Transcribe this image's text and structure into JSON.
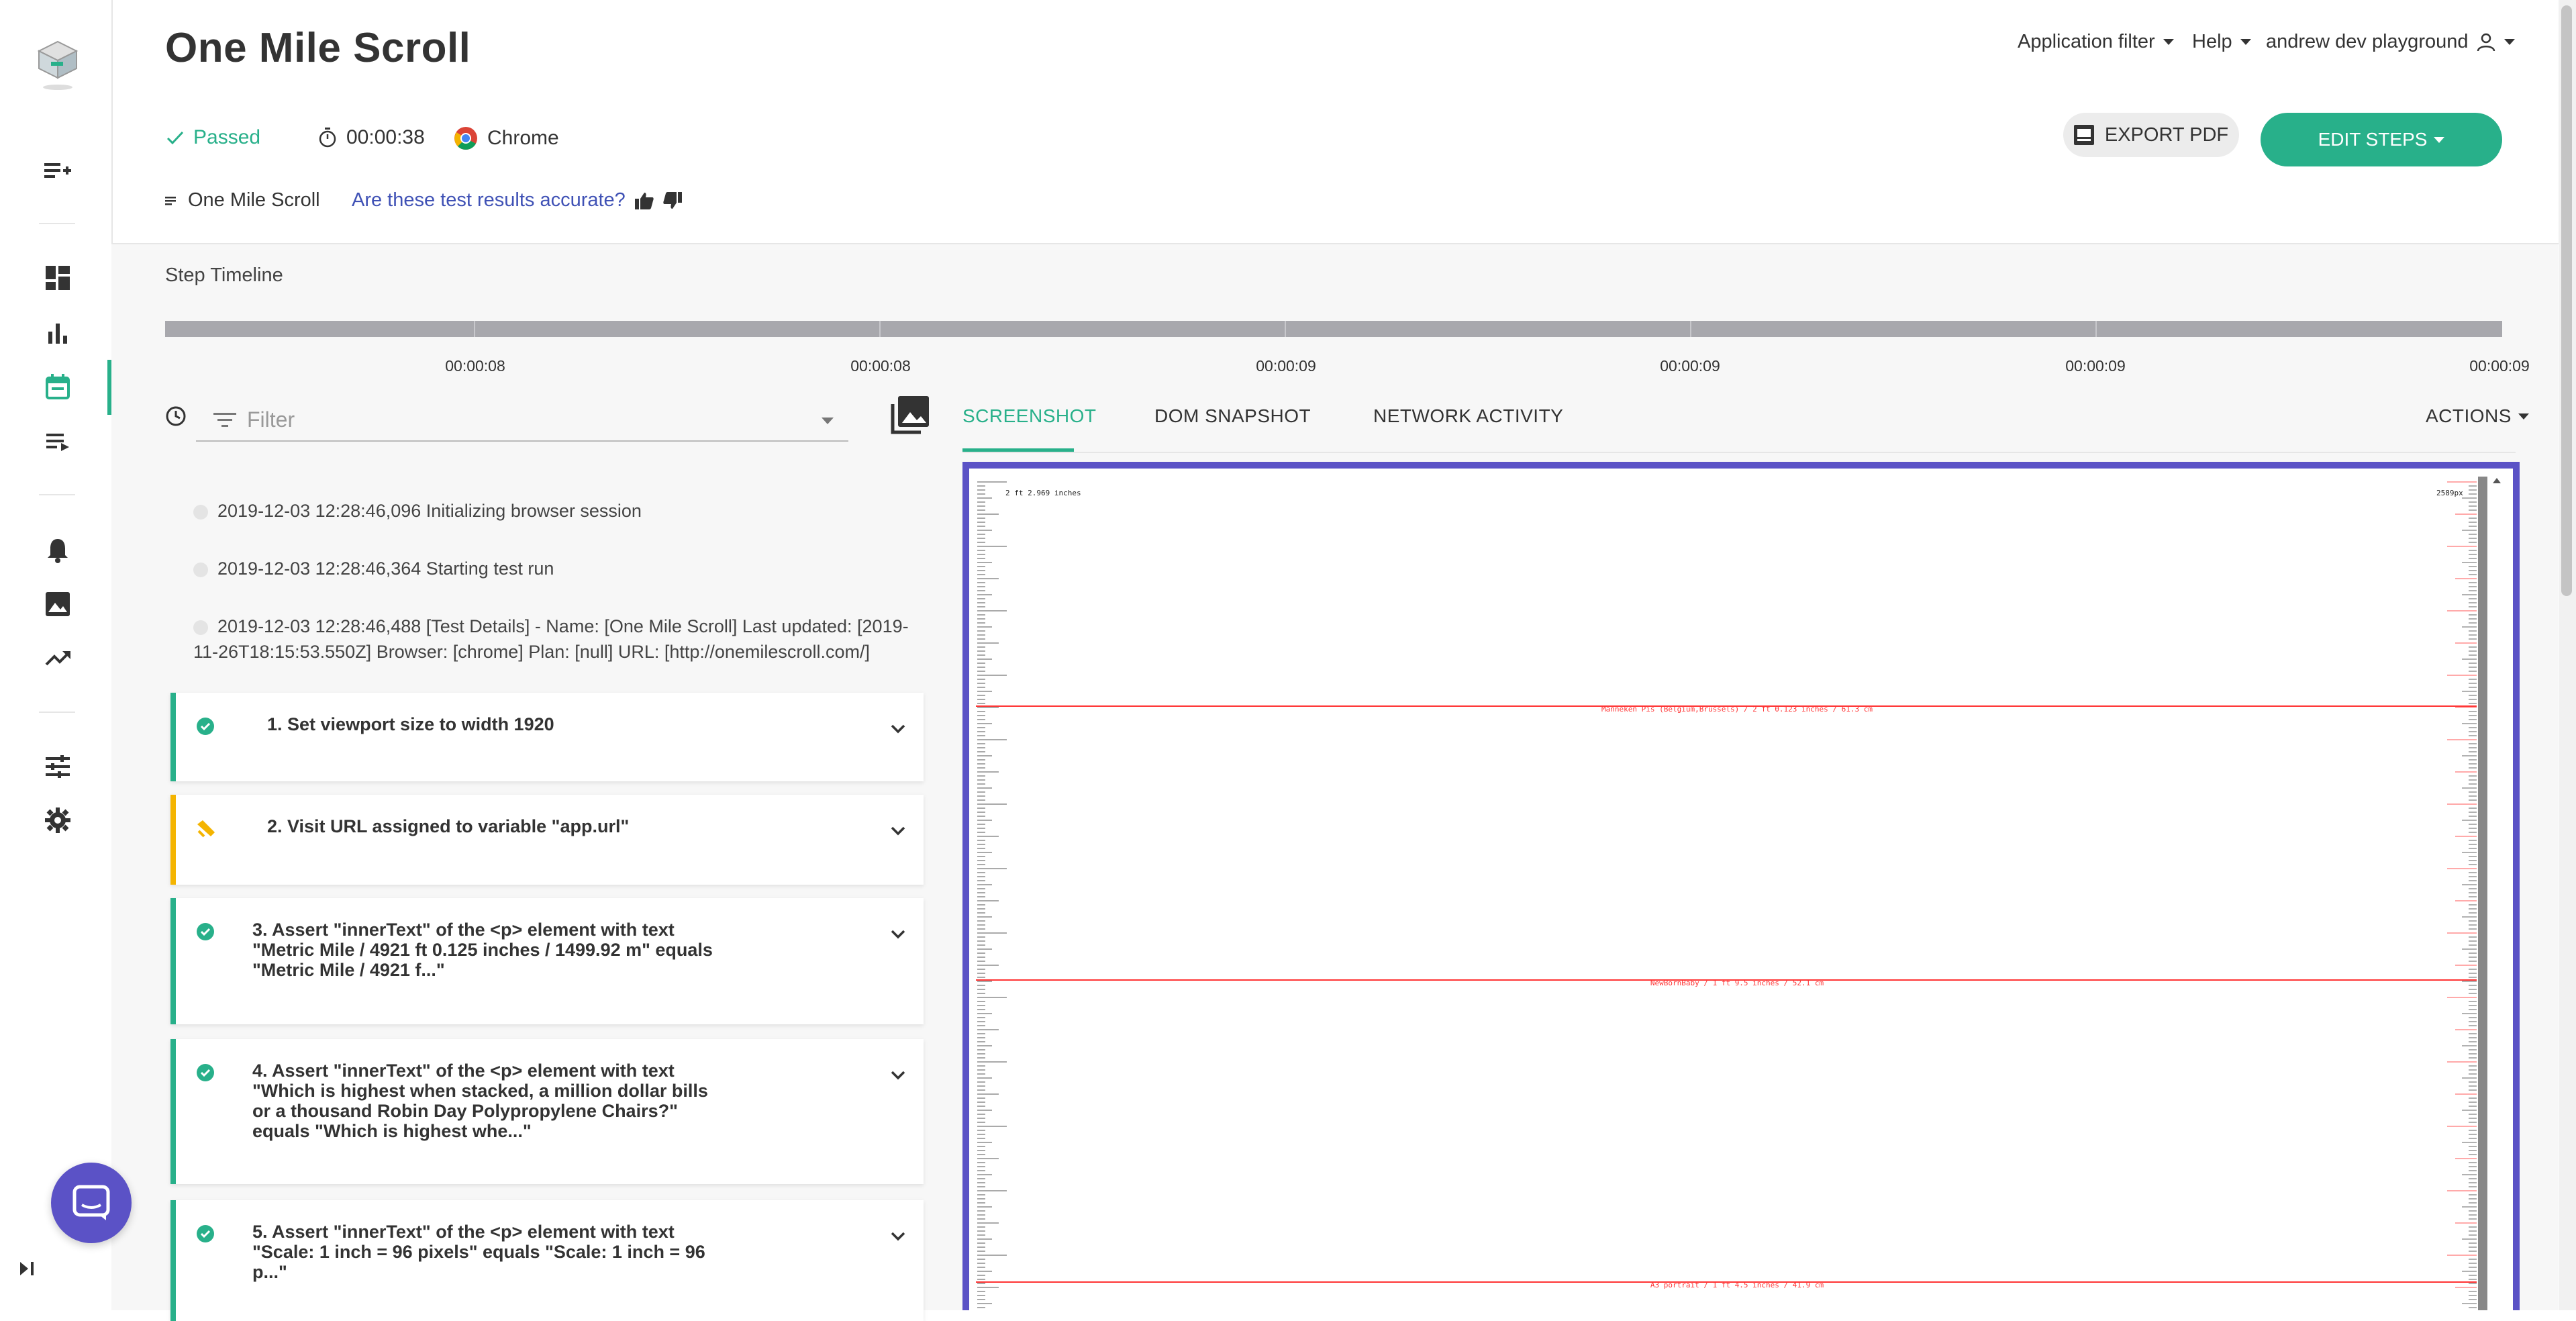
{
  "header": {
    "title": "One Mile Scroll",
    "nav": {
      "app_filter": "Application filter",
      "help": "Help",
      "user": "andrew dev playground"
    },
    "status": "Passed",
    "duration": "00:00:38",
    "browser": "Chrome",
    "plan_name": "One Mile Scroll",
    "feedback_prompt": "Are these test results accurate?",
    "export_label": "EXPORT PDF",
    "edit_label": "EDIT STEPS"
  },
  "timeline": {
    "title": "Step Timeline",
    "ticks": [
      "00:00:08",
      "00:00:08",
      "00:00:09",
      "00:00:09",
      "00:00:09",
      "00:00:09"
    ]
  },
  "log": {
    "filter_placeholder": "Filter",
    "lines": [
      "2019-12-03 12:28:46,096 Initializing browser session",
      "2019-12-03 12:28:46,364 Starting test run",
      "2019-12-03 12:28:46,488 [Test Details] - Name: [One Mile Scroll] Last updated: [2019-11-26T18:15:53.550Z] Browser: [chrome] Plan: [null] URL: [http://onemilescroll.com/]"
    ],
    "steps": [
      {
        "text": "1. Set viewport size to width 1920",
        "status": "passed"
      },
      {
        "text": "2. Visit URL assigned to variable \"app.url\"",
        "status": "warning"
      },
      {
        "text": "3. Assert \"innerText\" of the <p> element with text \"Metric Mile / 4921 ft 0.125 inches / 1499.92 m\" equals \"Metric Mile / 4921 f...\"",
        "status": "passed"
      },
      {
        "text": "4. Assert \"innerText\" of the <p> element with text \"Which is highest when stacked, a million dollar bills or a thousand Robin Day Polypropylene Chairs?\" equals \"Which is highest whe...\"",
        "status": "passed"
      },
      {
        "text": "5. Assert \"innerText\" of the <p> element with text \"Scale: 1 inch = 96 pixels\" equals \"Scale: 1 inch = 96 p...\"",
        "status": "passed"
      }
    ]
  },
  "viewer": {
    "tabs": [
      "SCREENSHOT",
      "DOM SNAPSHOT",
      "NETWORK ACTIVITY"
    ],
    "actions_label": "ACTIONS",
    "screenshot": {
      "top_left": "2 ft 2.969 inches",
      "top_right": "2589px",
      "markers": [
        "Manneken Pis (Belgium,Brussels) / 2 ft 0.123 inches / 61.3 cm",
        "NewBornBaby / 1 ft 9.5 inches / 52.1 cm",
        "A3 portrait / 1 ft 4.5 inches / 41.9 cm"
      ]
    }
  },
  "colors": {
    "accent": "#28b08a",
    "warning": "#f4b400",
    "frame": "#5b52c6",
    "link": "#3f51b5"
  }
}
